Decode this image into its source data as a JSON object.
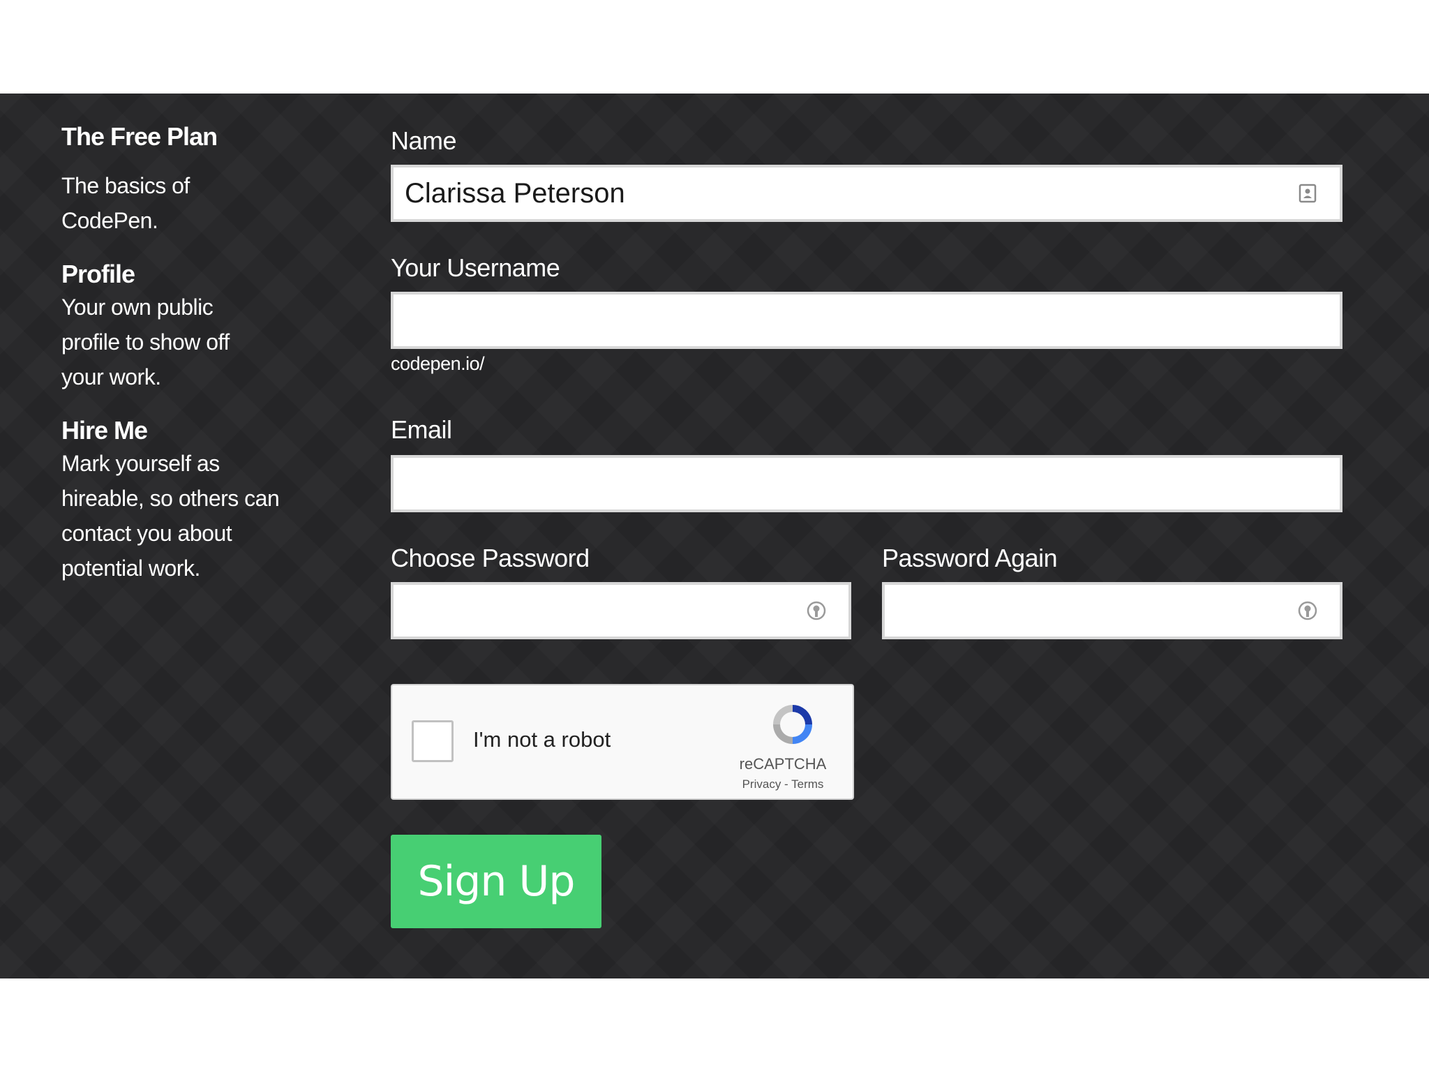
{
  "sidebar": {
    "title": "The Free Plan",
    "intro": "The basics of CodePen.",
    "features": [
      {
        "heading": "Profile",
        "text": "Your own public profile to show off your work."
      },
      {
        "heading": "Hire Me",
        "text": "Mark yourself as hireable, so others can contact you about potential work."
      }
    ]
  },
  "form": {
    "name": {
      "label": "Name",
      "value": "Clarissa Peterson",
      "icon": "contact-card-icon"
    },
    "username": {
      "label": "Your Username",
      "value": "",
      "hint": "codepen.io/"
    },
    "email": {
      "label": "Email",
      "value": ""
    },
    "password": {
      "label": "Choose Password",
      "value": "",
      "icon": "key-icon"
    },
    "password_again": {
      "label": "Password Again",
      "value": "",
      "icon": "key-icon"
    },
    "captcha": {
      "label": "I'm not a robot",
      "brand": "reCAPTCHA",
      "links": "Privacy - Terms",
      "checked": false
    },
    "submit_label": "Sign Up"
  },
  "colors": {
    "background": "#252527",
    "accent": "#47cf73",
    "text": "#ffffff"
  }
}
